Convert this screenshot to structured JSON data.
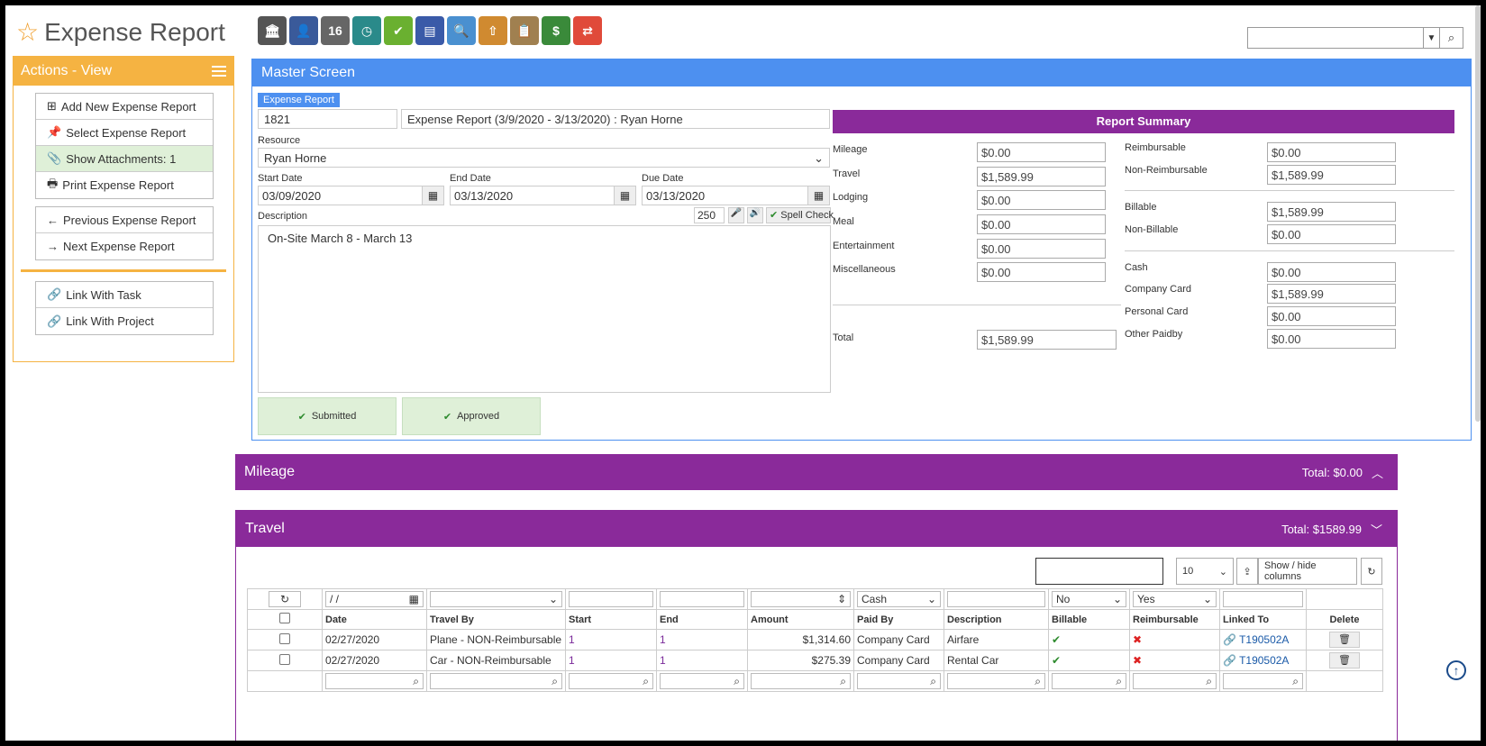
{
  "app": {
    "title": "Expense Report"
  },
  "toolbar": {
    "icons": [
      {
        "name": "bank-icon",
        "bg": "#555",
        "glyph": "🏛"
      },
      {
        "name": "user-icon",
        "bg": "#3a5a9a",
        "glyph": "👤"
      },
      {
        "name": "calendar-icon",
        "bg": "#666",
        "glyph": "16"
      },
      {
        "name": "clock-icon",
        "bg": "#2a8a8a",
        "glyph": "◷"
      },
      {
        "name": "checkmark-icon",
        "bg": "#6ab030",
        "glyph": "✔"
      },
      {
        "name": "keyboard-icon",
        "bg": "#3a5aa8",
        "glyph": "▤"
      },
      {
        "name": "magnifier-icon",
        "bg": "#4a90d0",
        "glyph": "🔍"
      },
      {
        "name": "upload-box-icon",
        "bg": "#d08a30",
        "glyph": "⇧"
      },
      {
        "name": "clipboard-icon",
        "bg": "#a08050",
        "glyph": "📋"
      },
      {
        "name": "money-icon",
        "bg": "#3a8a3a",
        "glyph": "$"
      },
      {
        "name": "sync-icon",
        "bg": "#e04a3a",
        "glyph": "⇄"
      }
    ]
  },
  "sidebar": {
    "title": "Actions - View",
    "group1": [
      {
        "name": "add-new-expense-report-button",
        "icon": "plus-square-icon",
        "glyph": "⊞",
        "label": "Add New Expense Report"
      },
      {
        "name": "select-expense-report-button",
        "icon": "pin-icon",
        "glyph": "📌",
        "label": "Select Expense Report"
      },
      {
        "name": "show-attachments-button",
        "icon": "paperclip-icon",
        "glyph": "📎",
        "label": "Show Attachments: 1",
        "active": true
      },
      {
        "name": "print-expense-report-button",
        "icon": "print-icon",
        "glyph": "🖶",
        "label": "Print Expense Report"
      }
    ],
    "group2": [
      {
        "name": "previous-expense-report-button",
        "icon": "arrow-left-icon",
        "glyph": "←",
        "label": "Previous Expense Report"
      },
      {
        "name": "next-expense-report-button",
        "icon": "arrow-right-icon",
        "glyph": "→",
        "label": "Next Expense Report"
      }
    ],
    "group3": [
      {
        "name": "link-with-task-button",
        "icon": "link-icon",
        "glyph": "🔗",
        "label": "Link With Task"
      },
      {
        "name": "link-with-project-button",
        "icon": "link-icon",
        "glyph": "🔗",
        "label": "Link With Project"
      }
    ]
  },
  "master": {
    "title": "Master Screen",
    "tag": "Expense Report",
    "id_value": "1821",
    "report_name": "Expense Report (3/9/2020 - 3/13/2020) : Ryan Horne",
    "resource_label": "Resource",
    "resource_value": "Ryan Horne",
    "start_label": "Start Date",
    "start_value": "03/09/2020",
    "end_label": "End Date",
    "end_value": "03/13/2020",
    "due_label": "Due Date",
    "due_value": "03/13/2020",
    "description_label": "Description",
    "char_count": "250",
    "spell_check": "Spell Check",
    "description": "On-Site March 8 - March 13",
    "submitted": "Submitted",
    "approved": "Approved"
  },
  "summary": {
    "title": "Report Summary",
    "left": [
      {
        "label": "Mileage",
        "value": "$0.00"
      },
      {
        "label": "Travel",
        "value": "$1,589.99"
      },
      {
        "label": "Lodging",
        "value": "$0.00"
      },
      {
        "label": "Meal",
        "value": "$0.00"
      },
      {
        "label": "Entertainment",
        "value": "$0.00"
      },
      {
        "label": "Miscellaneous",
        "value": "$0.00"
      }
    ],
    "total_label": "Total",
    "total_value": "$1,589.99",
    "right_a": [
      {
        "label": "Reimbursable",
        "value": "$0.00"
      },
      {
        "label": "Non-Reimbursable",
        "value": "$1,589.99"
      }
    ],
    "right_b": [
      {
        "label": "Billable",
        "value": "$1,589.99"
      },
      {
        "label": "Non-Billable",
        "value": "$0.00"
      }
    ],
    "right_c": [
      {
        "label": "Cash",
        "value": "$0.00"
      },
      {
        "label": "Company Card",
        "value": "$1,589.99"
      },
      {
        "label": "Personal Card",
        "value": "$0.00"
      },
      {
        "label": "Other Paidby",
        "value": "$0.00"
      }
    ]
  },
  "mileage": {
    "title": "Mileage",
    "total": "Total: $0.00"
  },
  "travel": {
    "title": "Travel",
    "total": "Total: $1589.99",
    "page_size": "10",
    "show_hide": "Show / hide columns",
    "filters": {
      "date": " /  /",
      "paid_by": "Cash",
      "billable": "No",
      "reimbursable": "Yes"
    },
    "columns": [
      "Date",
      "Travel By",
      "Start",
      "End",
      "Amount",
      "Paid By",
      "Description",
      "Billable",
      "Reimbursable",
      "Linked To",
      "Delete"
    ],
    "rows": [
      {
        "date": "02/27/2020",
        "travel_by": "Plane - NON-Reimbursable",
        "start": "1",
        "end": "1",
        "amount": "$1,314.60",
        "paid_by": "Company Card",
        "description": "Airfare",
        "linked": "T190502A"
      },
      {
        "date": "02/27/2020",
        "travel_by": "Car - NON-Reimbursable",
        "start": "1",
        "end": "1",
        "amount": "$275.39",
        "paid_by": "Company Card",
        "description": "Rental Car",
        "linked": "T190502A"
      }
    ]
  }
}
